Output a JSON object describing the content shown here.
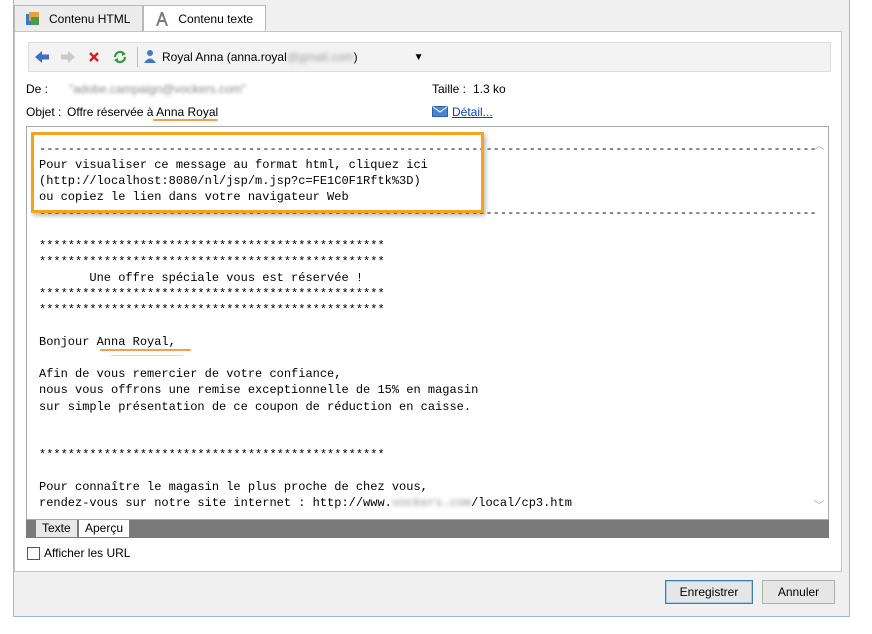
{
  "tabs": [
    {
      "label": "Contenu HTML",
      "icon": "html-content-icon"
    },
    {
      "label": "Contenu texte",
      "icon": "text-content-icon"
    }
  ],
  "toolbar": {
    "back_icon": "arrow-left-icon",
    "forward_icon": "arrow-right-icon",
    "delete_icon": "delete-x-icon",
    "refresh_icon": "refresh-icon",
    "recipient_name": "Royal Anna (anna.royal",
    "recipient_domain_blurred": "@gmail.com",
    "recipient_suffix": ")"
  },
  "header": {
    "from_label": "De :",
    "from_value": "\"adobe.campaign@vockers.com\"",
    "size_label": "Taille :",
    "size_value": "1.3 ko",
    "subject_label": "Objet :",
    "subject_prefix": "Offre réservée à ",
    "subject_name": "Anna Royal",
    "detail_link": "Détail..."
  },
  "message": {
    "lines_top": "------------------------------------------------------------------------------------------------------------\nPour visualiser ce message au format html, cliquez ici\n(http://localhost:8080/nl/jsp/m.jsp?c=FE1C0F1Rftk%3D)\nou copiez le lien dans votre navigateur Web\n------------------------------------------------------------------------------------------------------------\n\n************************************************\n************************************************\n       Une offre spéciale vous est réservée !\n************************************************\n************************************************\n\nBonjour Anna Royal,\n\nAfin de vous remercier de votre confiance,\nnous vous offrons une remise exceptionnelle de 15% en magasin\nsur simple présentation de ce coupon de réduction en caisse.\n\n\n************************************************\n\nPour connaître le magasin le plus proche de chez vous,\nrendez-vous sur notre site internet : http://www.",
    "url_blurred": "vockers.com",
    "url_suffix": "/local/cp3.htm"
  },
  "bottom_tabs": [
    {
      "label": "Texte"
    },
    {
      "label": "Aperçu"
    }
  ],
  "show_urls_label": "Afficher les URL",
  "show_urls_checked": false,
  "buttons": {
    "save": "Enregistrer",
    "cancel": "Annuler"
  },
  "colors": {
    "highlight": "#f5a21d",
    "link": "#0645ad"
  }
}
